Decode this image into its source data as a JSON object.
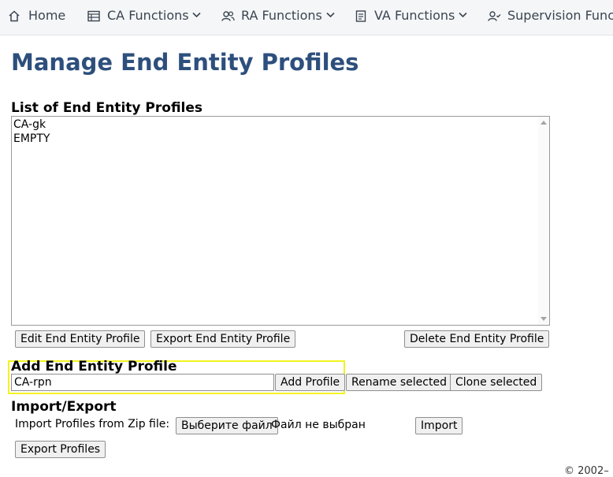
{
  "nav": {
    "items": [
      {
        "label": "Home",
        "icon": "home-icon"
      },
      {
        "label": "CA Functions",
        "icon": "ca-functions-icon"
      },
      {
        "label": "RA Functions",
        "icon": "users-icon"
      },
      {
        "label": "VA Functions",
        "icon": "document-icon"
      },
      {
        "label": "Supervision Funct",
        "icon": "user-check-icon"
      }
    ]
  },
  "page": {
    "title": "Manage End Entity Profiles"
  },
  "list_section": {
    "title": "List of End Entity Profiles",
    "profiles": [
      "CA-gk",
      "EMPTY"
    ],
    "edit_button": "Edit End Entity Profile",
    "export_button": "Export End Entity Profile",
    "delete_button": "Delete End Entity Profile"
  },
  "add_section": {
    "title": "Add End Entity Profile",
    "input_value": "CA-rpn",
    "add_button": "Add Profile",
    "rename_button": "Rename selected",
    "clone_button": "Clone selected"
  },
  "import_section": {
    "title": "Import/Export",
    "import_label": "Import Profiles from Zip file:",
    "choose_file_button": "Выберите файл",
    "no_file_text": "Файл не выбран",
    "import_button": "Import",
    "export_profiles_button": "Export Profiles"
  },
  "footer": {
    "text": "© 2002–"
  },
  "colors": {
    "title": "#2d4f7c",
    "nav_background": "#f5f6f7",
    "highlight": "#f3f31f"
  }
}
